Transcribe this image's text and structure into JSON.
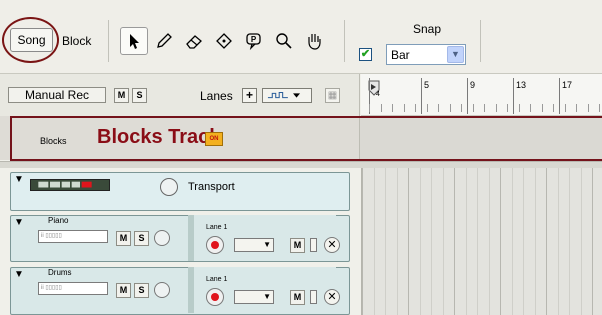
{
  "toolbar": {
    "song_label": "Song",
    "block_label": "Block",
    "snap_label": "Snap",
    "snap_checked": true,
    "snap_value": "Bar",
    "tools": [
      "select-arrow-icon",
      "pencil-icon",
      "eraser-icon",
      "paint-bucket-icon",
      "speech-bubble-icon",
      "magnifier-icon",
      "hand-icon"
    ]
  },
  "track_header": {
    "manual_rec": "Manual Rec",
    "m": "M",
    "s": "S",
    "lanes_label": "Lanes",
    "add_symbol": "+"
  },
  "ruler": {
    "numbers": [
      "5",
      "9",
      "13",
      "17"
    ],
    "marker_sub": "4"
  },
  "blocks": {
    "small_label": "Blocks",
    "big_label": "Blocks Track",
    "on_badge": "ON",
    "accent": "#8a0d16"
  },
  "transport": {
    "label": "Transport"
  },
  "tracks": [
    {
      "name": "Piano",
      "lane": "Lane 1"
    },
    {
      "name": "Drums",
      "lane": "Lane 1"
    }
  ],
  "common": {
    "m": "M",
    "s": "S",
    "x": "✕"
  }
}
